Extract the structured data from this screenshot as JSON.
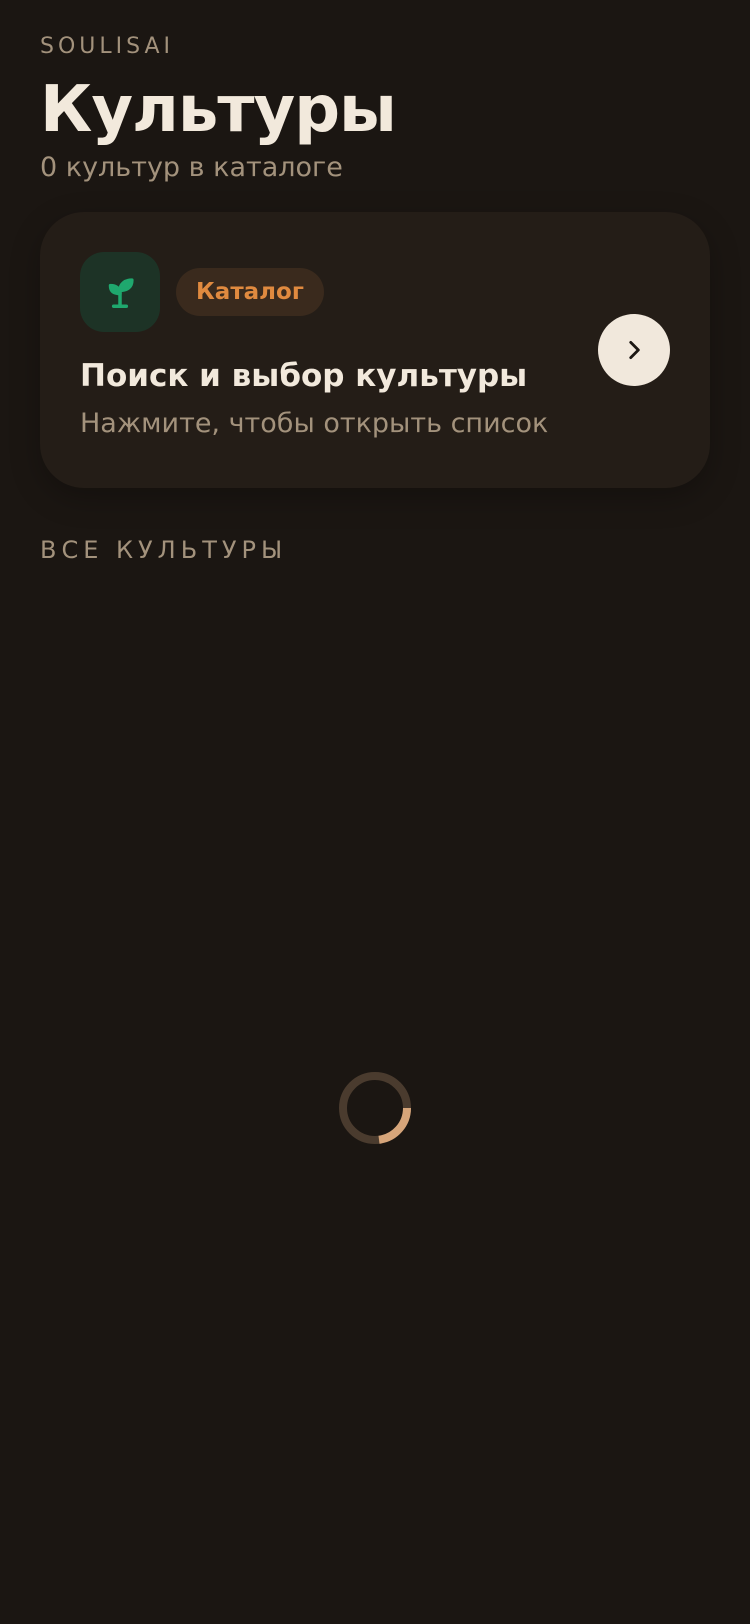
{
  "header": {
    "brand": "SOULISAI",
    "title": "Культуры",
    "subtitle": "0 культур в каталоге"
  },
  "catalog_card": {
    "icon": "sprout-icon",
    "badge": "Каталог",
    "title": "Поиск и выбор культуры",
    "hint": "Нажмите, чтобы открыть список",
    "action_icon": "chevron-right-icon"
  },
  "all_cultures": {
    "section_label": "ВСЕ КУЛЬТУРЫ",
    "state": "loading"
  },
  "colors": {
    "background": "#1b1612",
    "card": "#241d17",
    "accent_orange": "#e08a3f",
    "sprout_green": "#1fa86e",
    "spinner_active": "#d6a57a",
    "spinner_track": "#4a3b2e"
  }
}
